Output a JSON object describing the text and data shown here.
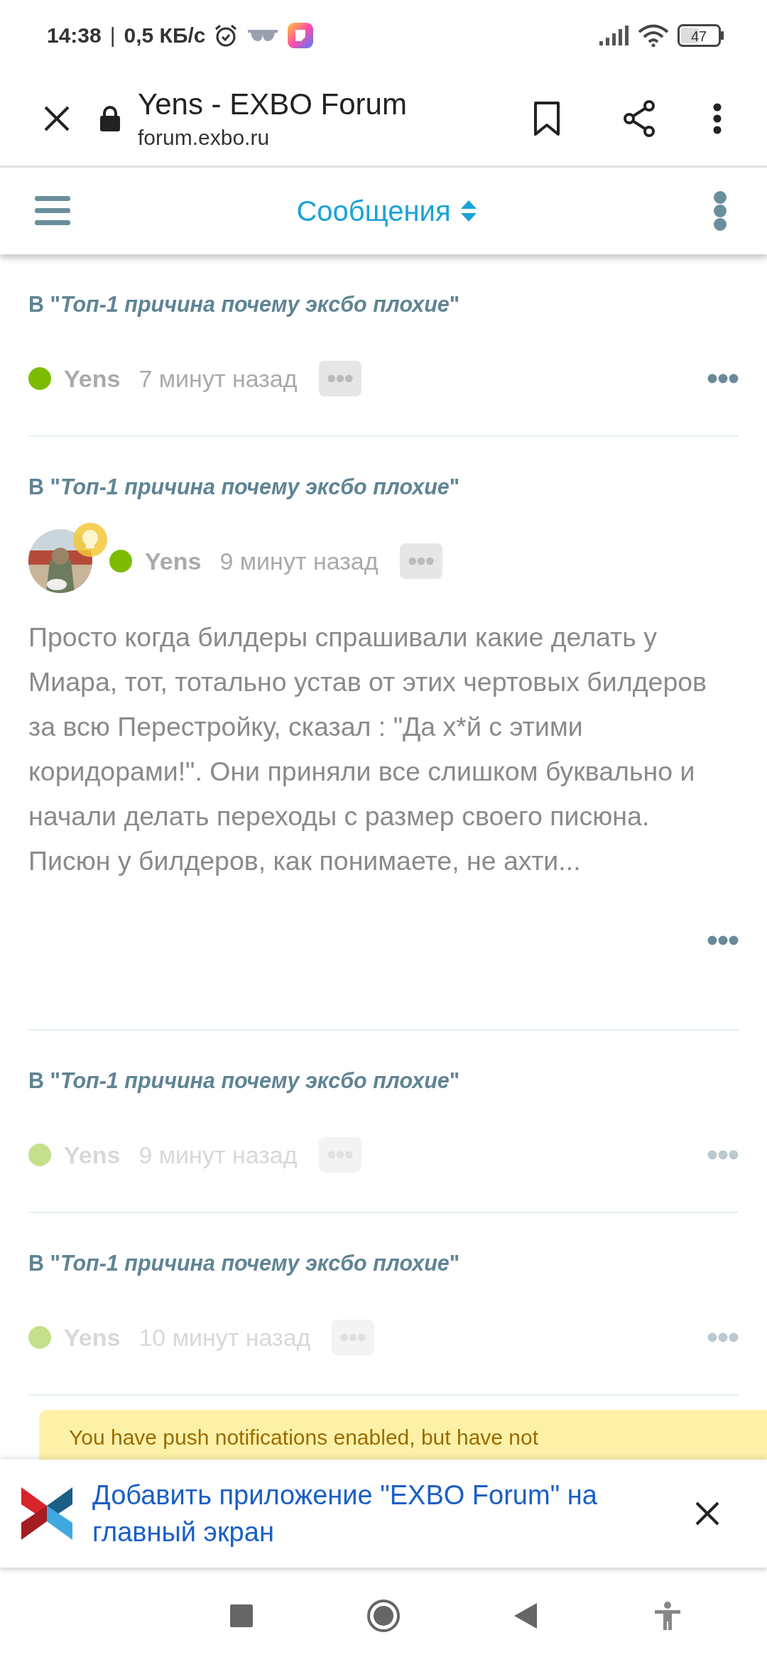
{
  "status_bar": {
    "time": "14:38",
    "separator": "|",
    "speed": "0,5 КБ/с",
    "battery": "47"
  },
  "browser": {
    "title": "Yens - EXBO Forum",
    "url": "forum.exbo.ru"
  },
  "forum_header": {
    "title": "Сообщения"
  },
  "posts": [
    {
      "topic": "В \"*Топ-1 причина почему эксбо плохие*\"",
      "author": "Yens",
      "time": "7 минут назад",
      "faded": false,
      "avatar": false,
      "online": true
    },
    {
      "topic": "В \"*Топ-1 причина почему эксбо плохие*\"",
      "author": "Yens",
      "time": "9 минут назад",
      "faded": false,
      "avatar": true,
      "online": true,
      "body": "Просто когда билдеры спрашивали какие делать у Миара, тот, тотально устав от этих чертовых билдеров за всю Перестройку, сказал : \"Да х*й с этими коридорами!\". Они приняли все слишком буквально и начали делать переходы с размер своего писюна. Писюн у билдеров, как понимаете, не ахти..."
    },
    {
      "topic": "В \"*Топ-1 причина почему эксбо плохие*\"",
      "author": "Yens",
      "time": "9 минут назад",
      "faded": true,
      "avatar": false,
      "online": true
    },
    {
      "topic": "В \"*Топ-1 причина почему эксбо плохие*\"",
      "author": "Yens",
      "time": "10 минут назад",
      "faded": true,
      "avatar": false,
      "online": true
    }
  ],
  "notification": {
    "text": "You have push notifications enabled, but have not"
  },
  "install_banner": {
    "text": "Добавить приложение \"EXBO Forum\" на главный экран"
  }
}
